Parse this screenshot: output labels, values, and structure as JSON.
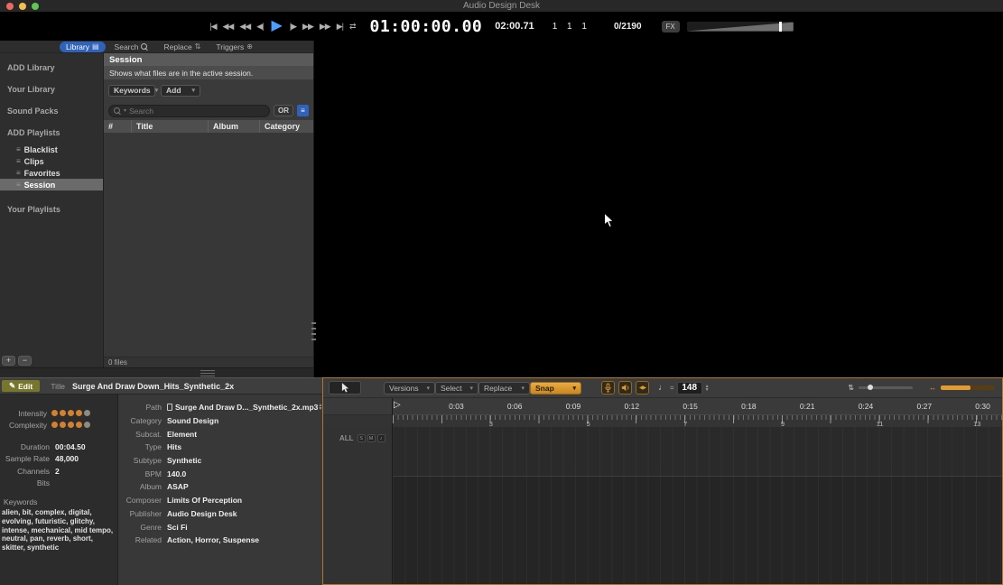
{
  "titlebar": {
    "title": "Audio Design Desk"
  },
  "transport": {
    "buttons": [
      {
        "name": "go-to-start",
        "glyph": "|◀"
      },
      {
        "name": "previous-section",
        "glyph": "◀◀"
      },
      {
        "name": "rewind",
        "glyph": "◀◀"
      },
      {
        "name": "step-back",
        "glyph": "◀|"
      },
      {
        "name": "play",
        "glyph": "▶"
      },
      {
        "name": "step-forward",
        "glyph": "|▶"
      },
      {
        "name": "fast-forward",
        "glyph": "▶▶"
      },
      {
        "name": "next-section",
        "glyph": "▶▶"
      },
      {
        "name": "go-to-end",
        "glyph": "▶|"
      },
      {
        "name": "loop",
        "glyph": "⇄"
      }
    ],
    "timecode": "01:00:00.00",
    "time_secondary": "02:00.71",
    "bars_beats": "1 1 1",
    "counter": "0/2190",
    "fx_label": "FX"
  },
  "library": {
    "tabs": [
      {
        "label": "Library",
        "icon": "▤"
      },
      {
        "label": "Search",
        "icon": ""
      },
      {
        "label": "Replace",
        "icon": "⇅"
      },
      {
        "label": "Triggers",
        "icon": "⊕"
      }
    ],
    "nav": {
      "sections": [
        {
          "label": "ADD Library"
        },
        {
          "label": "Your Library"
        },
        {
          "label": "Sound Packs"
        },
        {
          "label": "ADD Playlists"
        }
      ],
      "playlists": [
        {
          "label": "Blacklist"
        },
        {
          "label": "Clips"
        },
        {
          "label": "Favorites"
        },
        {
          "label": "Session"
        }
      ],
      "your_playlists": "Your Playlists"
    },
    "panel": {
      "title": "Session",
      "description": "Shows what files are in the active session.",
      "filter_keywords": "Keywords",
      "filter_add": "Add",
      "search_placeholder": "Search",
      "or_label": "OR",
      "columns": [
        {
          "label": "#"
        },
        {
          "label": "Title"
        },
        {
          "label": "Album"
        },
        {
          "label": "Category"
        }
      ],
      "footer": "0 files"
    }
  },
  "info": {
    "edit_icon": "✎",
    "edit_label": "Edit",
    "title_label": "Title",
    "title_value": "Surge And Draw Down_Hits_Synthetic_2x",
    "intensity": {
      "label": "Intensity",
      "value": 4,
      "max": 5
    },
    "complexity": {
      "label": "Complexity",
      "value": 4,
      "max": 5
    },
    "stats": [
      {
        "label": "Duration",
        "value": "00:04.50"
      },
      {
        "label": "Sample Rate",
        "value": "48,000"
      },
      {
        "label": "Channels",
        "value": "2"
      },
      {
        "label": "Bits",
        "value": ""
      }
    ],
    "keywords_label": "Keywords",
    "keywords": "alien, bit, complex, digital, evolving, futuristic, glitchy, intense, mechanical, mid tempo, neutral, pan, reverb, short, skitter, synthetic",
    "fields": [
      {
        "label": "Path",
        "value": "Surge And Draw D..._Synthetic_2x.mp3"
      },
      {
        "label": "Category",
        "value": "Sound Design"
      },
      {
        "label": "Subcat.",
        "value": "Element"
      },
      {
        "label": "Type",
        "value": "Hits"
      },
      {
        "label": "Subtype",
        "value": "Synthetic"
      },
      {
        "label": "BPM",
        "value": "140.0"
      },
      {
        "label": "Album",
        "value": "ASAP"
      },
      {
        "label": "Composer",
        "value": "Limits Of Perception"
      },
      {
        "label": "Publisher",
        "value": "Audio Design Desk"
      },
      {
        "label": "Genre",
        "value": "Sci Fi"
      },
      {
        "label": "Related",
        "value": "Action, Horror, Suspense"
      }
    ]
  },
  "timeline": {
    "toolbar": {
      "versions": "Versions",
      "select": "Select",
      "replace": "Replace",
      "snap": "Snap",
      "arrows_icon": "◀▶",
      "tempo_note": "♩",
      "tempo_eq": "=",
      "tempo": "148",
      "pitch_icon": "⇅",
      "stretch_icon": "↔"
    },
    "ruler": {
      "times": [
        "0:03",
        "0:06",
        "0:09",
        "0:12",
        "0:15",
        "0:18",
        "0:21",
        "0:24",
        "0:27",
        "0:30"
      ],
      "bars": [
        "3",
        "5",
        "7",
        "9",
        "11",
        "13"
      ],
      "all_label": "ALL",
      "track_buttons": [
        {
          "label": "S"
        },
        {
          "label": "M"
        },
        {
          "label": "♪"
        }
      ]
    }
  },
  "colors": {
    "accent_blue": "#2f62b8",
    "accent_orange": "#d79a2b",
    "play_blue": "#4aa0ff"
  }
}
